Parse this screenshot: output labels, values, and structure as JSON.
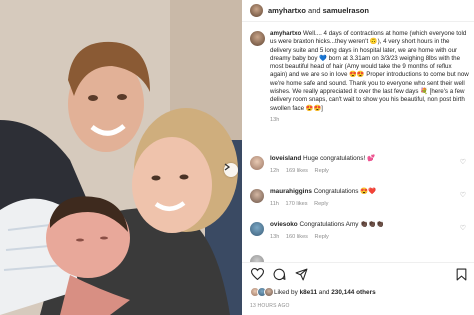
{
  "post": {
    "username": "amyhartxo",
    "and_text": "and",
    "collaborator": "samuelrason",
    "caption": "Well.... 4 days of contractions at home (which everyone told us were braxton hicks...they weren't 🙃), 4 very short hours in the delivery suite and 5 long days in hospital later, we are home with our dreamy baby boy 💙 born at 3.31am on 3/3/23 weighing 8lbs with the most beautiful head of hair (Amy would take the 9 months of reflux again) and we are so in love 😍😍 Proper introductions to come but now we're home safe and sound. Thank you to everyone who sent their well wishes. We really appreciated it over the last few days 💐 [here's a few delivery room snaps, can't wait to show you his beautiful, non post birth swollen face 😍😍]",
    "caption_time": "13h",
    "liked_by_label": "Liked by",
    "liked_by_user": "k8e11",
    "likes_and": "and",
    "likes_count": "230,144 others",
    "time_ago": "13 HOURS AGO"
  },
  "comments": [
    {
      "user": "loveisland",
      "text": "Huge congratulations! 💕",
      "time": "12h",
      "likes": "169 likes",
      "reply": "Reply"
    },
    {
      "user": "maurahiggins",
      "text": "Congratulations 😍❤️",
      "time": "11h",
      "likes": "170 likes",
      "reply": "Reply"
    },
    {
      "user": "oviesoko",
      "text": "Congratulations Amy 👏🏿👏🏿👏🏿",
      "time": "13h",
      "likes": "160 likes",
      "reply": "Reply"
    }
  ],
  "icons": {
    "heart": "heart-icon",
    "comment": "comment-icon",
    "share": "share-icon",
    "save": "bookmark-icon",
    "next": "chevron-right-icon"
  },
  "colors": {
    "text": "#262626",
    "muted": "#8e8e8e",
    "divider": "#efefef",
    "background": "#ffffff"
  }
}
